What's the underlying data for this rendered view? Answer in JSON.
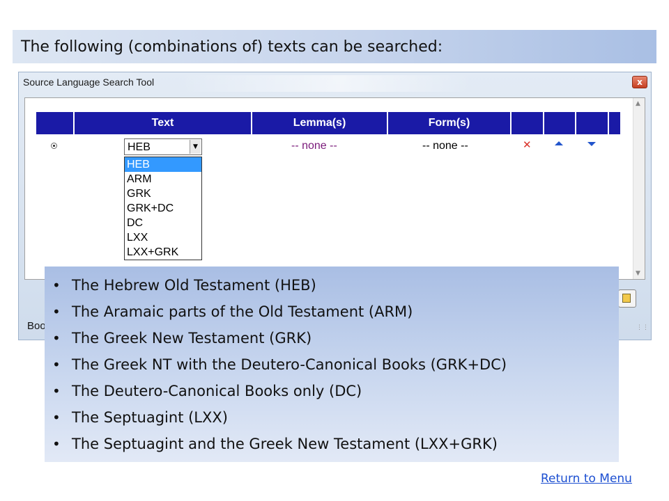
{
  "slide": {
    "title": "The following (combinations of) texts can be searched:",
    "return_link": "Return to Menu"
  },
  "tool": {
    "window_title": "Source Language Search Tool",
    "close_glyph": "x",
    "columns": [
      "",
      "Text",
      "Lemma(s)",
      "Form(s)",
      "",
      "",
      ""
    ],
    "row": {
      "text_selected": "HEB",
      "lemma": "-- none --",
      "form": "-- none --"
    },
    "text_options": [
      "HEB",
      "ARM",
      "GRK",
      "GRK+DC",
      "DC",
      "LXX",
      "LXX+GRK"
    ],
    "status_partial": "Boo",
    "icons": {
      "delete": "red-x-icon",
      "move_up": "blue-up-triangle-icon",
      "move_down": "blue-down-triangle-icon",
      "dropdown": "chevron-down-icon",
      "side_button": "paste-icon"
    }
  },
  "bullets": [
    "The Hebrew Old Testament (HEB)",
    "The Aramaic parts of the Old Testament (ARM)",
    "The Greek New Testament (GRK)",
    "The Greek NT with the Deutero-Canonical Books (GRK+DC)",
    "The Deutero-Canonical Books only (DC)",
    "The Septuagint (LXX)",
    "The Septuagint and the Greek New Testament (LXX+GRK)"
  ],
  "colors": {
    "header_blue": "#1a1aa6",
    "dropdown_highlight": "#3399ff",
    "lemma_text": "#7a1a7a",
    "link": "#1c4fd1"
  }
}
